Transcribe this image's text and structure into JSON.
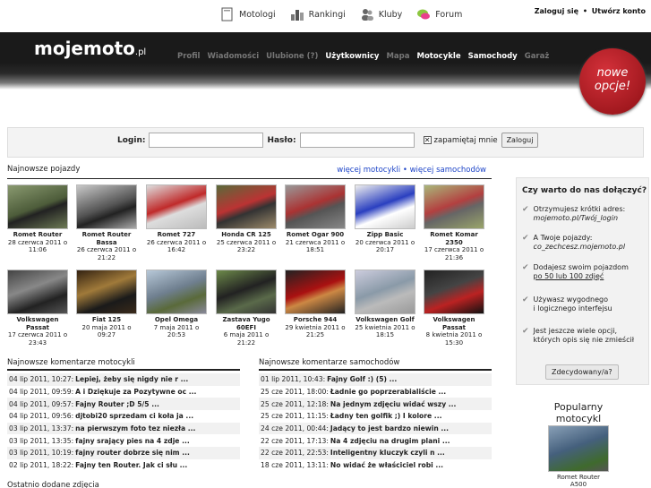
{
  "top": {
    "nav": [
      {
        "label": "Motologi",
        "icon": "book-icon"
      },
      {
        "label": "Rankingi",
        "icon": "ranking-icon"
      },
      {
        "label": "Kluby",
        "icon": "users-icon"
      },
      {
        "label": "Forum",
        "icon": "forum-icon"
      }
    ],
    "login_link": "Zaloguj się",
    "sep": "•",
    "register_link": "Utwórz konto"
  },
  "header": {
    "logo": "mojemoto",
    "logo_tld": ".pl",
    "menu": [
      "Profil",
      "Wiadomości",
      "Ulubione (?)",
      "Użytkownicy",
      "Mapa",
      "Motocykle",
      "Samochody",
      "Garaż"
    ],
    "badge_line1": "nowe",
    "badge_line2": "opcje!"
  },
  "login": {
    "login_label": "Login:",
    "password_label": "Hasło:",
    "remember": "zapamiętaj mnie",
    "button": "Zaloguj"
  },
  "vehicles": {
    "title": "Najnowsze pojazdy",
    "more_moto": "więcej motocykli",
    "sep": "•",
    "more_cars": "więcej samochodów",
    "items": [
      {
        "name": "Romet Router",
        "date": "28 czerwca 2011 o",
        "time": "11:06"
      },
      {
        "name": "Romet Router Bassa",
        "date": "26 czerwca 2011 o",
        "time": "21:22"
      },
      {
        "name": "Romet 727",
        "date": "26 czerwca 2011 o",
        "time": "16:42"
      },
      {
        "name": "Honda CR 125",
        "date": "25 czerwca 2011 o",
        "time": "23:22"
      },
      {
        "name": "Romet Ogar 900",
        "date": "21 czerwca 2011 o",
        "time": "18:51"
      },
      {
        "name": "Zipp Basic",
        "date": "20 czerwca 2011 o",
        "time": "20:17"
      },
      {
        "name": "Romet Komar 2350",
        "date": "17 czerwca 2011 o",
        "time": "21:36"
      },
      {
        "name": "Volkswagen Passat",
        "date": "17 czerwca 2011 o",
        "time": "23:43"
      },
      {
        "name": "Fiat 125",
        "date": "20 maja 2011 o",
        "time": "09:27"
      },
      {
        "name": "Opel Omega",
        "date": "7 maja 2011 o",
        "time": "20:53"
      },
      {
        "name": "Zastava Yugo 60EFI",
        "date": "6 maja 2011 o",
        "time": "21:22"
      },
      {
        "name": "Porsche 944",
        "date": "29 kwietnia 2011 o",
        "time": "21:25"
      },
      {
        "name": "Volkswagen Golf",
        "date": "25 kwietnia 2011 o",
        "time": "18:15"
      },
      {
        "name": "Volkswagen Passat",
        "date": "8 kwietnia 2011 o",
        "time": "15:30"
      }
    ]
  },
  "comments_moto": {
    "title": "Najnowsze komentarze motocykli",
    "rows": [
      {
        "date": "04 lip 2011, 10:27:",
        "text": "Lepiej, żeby się nigdy nie r ..."
      },
      {
        "date": "04 lip 2011, 09:59:",
        "text": "A i Dziękuje za Pozytywne oc ..."
      },
      {
        "date": "04 lip 2011, 09:57:",
        "text": "Fajny Router ;D 5/5 ..."
      },
      {
        "date": "04 lip 2011, 09:56:",
        "text": "djtobi20 sprzedam ci koła ja ..."
      },
      {
        "date": "03 lip 2011, 13:37:",
        "text": "na pierwszym foto tez niezła ..."
      },
      {
        "date": "03 lip 2011, 13:35:",
        "text": "fajny srający pies na 4 zdje ..."
      },
      {
        "date": "03 lip 2011, 10:19:",
        "text": "fajny router dobrze się nim ..."
      },
      {
        "date": "02 lip 2011, 18:22:",
        "text": "Fajny ten Router. Jak ci słu ..."
      }
    ]
  },
  "comments_cars": {
    "title": "Najnowsze komentarze samochodów",
    "rows": [
      {
        "date": "01 lip 2011, 10:43:",
        "text": "Fajny Golf :) (5) ..."
      },
      {
        "date": "25 cze 2011, 18:00:",
        "text": "Ładnie go poprzerabialiście ..."
      },
      {
        "date": "25 cze 2011, 12:18:",
        "text": "Na jednym zdjęciu widać wszy ..."
      },
      {
        "date": "25 cze 2011, 11:15:",
        "text": "Ładny ten golfik ;) I kolore ..."
      },
      {
        "date": "24 cze 2011, 00:44:",
        "text": "Jadący to jest bardzo niewin ..."
      },
      {
        "date": "22 cze 2011, 17:13:",
        "text": "Na 4 zdjęciu na drugim plani ..."
      },
      {
        "date": "22 cze 2011, 22:53:",
        "text": "Inteligentny kluczyk czyli n ..."
      },
      {
        "date": "18 cze 2011, 13:11:",
        "text": "No widać że właściciel robi ..."
      }
    ]
  },
  "last_photos": "Ostatnio dodane zdjęcia",
  "why": {
    "title": "Czy warto do nas dołączyć?",
    "item1_a": "Otrzymujesz krótki adres:",
    "item1_b": "mojemoto.pl/Twój_login",
    "item2_a": "A Twoje pojazdy:",
    "item2_b": "co_zechcesz.mojemoto.pl",
    "item3_a": "Dodajesz swoim pojazdom",
    "item3_b": "po 50 lub 100 zdjęć",
    "item4_a": "Używasz wygodnego",
    "item4_b": "i logicznego interfejsu",
    "item5_a": "Jest jeszcze wiele opcji,",
    "item5_b": "których opis się nie zmieścił",
    "button": "Zdecydowany/a?"
  },
  "popular": {
    "title_1": "Popularny",
    "title_2": "motocykl",
    "name": "Romet Router",
    "sub": "A500"
  }
}
